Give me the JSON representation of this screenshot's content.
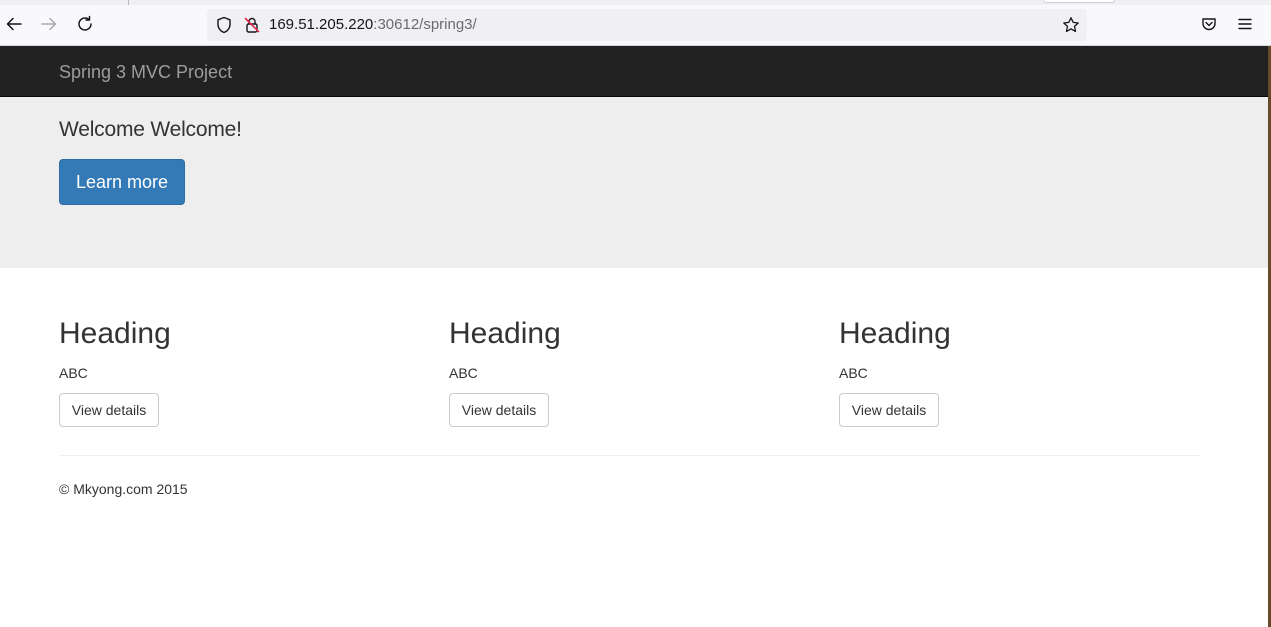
{
  "browser": {
    "url_host": "169.51.205.220",
    "url_path": ":30612/spring3/",
    "icons": [
      "back-icon",
      "forward-icon",
      "reload-icon",
      "shield-icon",
      "insecure-lock-icon",
      "star-icon",
      "pocket-icon",
      "menu-icon"
    ]
  },
  "navbar": {
    "brand": "Spring 3 MVC Project",
    "color": "#222222"
  },
  "jumbotron": {
    "title": "Welcome Welcome!",
    "button_label": "Learn more",
    "button_color": "#337ab7"
  },
  "columns": [
    {
      "heading": "Heading",
      "text": "ABC",
      "button_label": "View details"
    },
    {
      "heading": "Heading",
      "text": "ABC",
      "button_label": "View details"
    },
    {
      "heading": "Heading",
      "text": "ABC",
      "button_label": "View details"
    }
  ],
  "footer": {
    "text": "© Mkyong.com 2015"
  }
}
